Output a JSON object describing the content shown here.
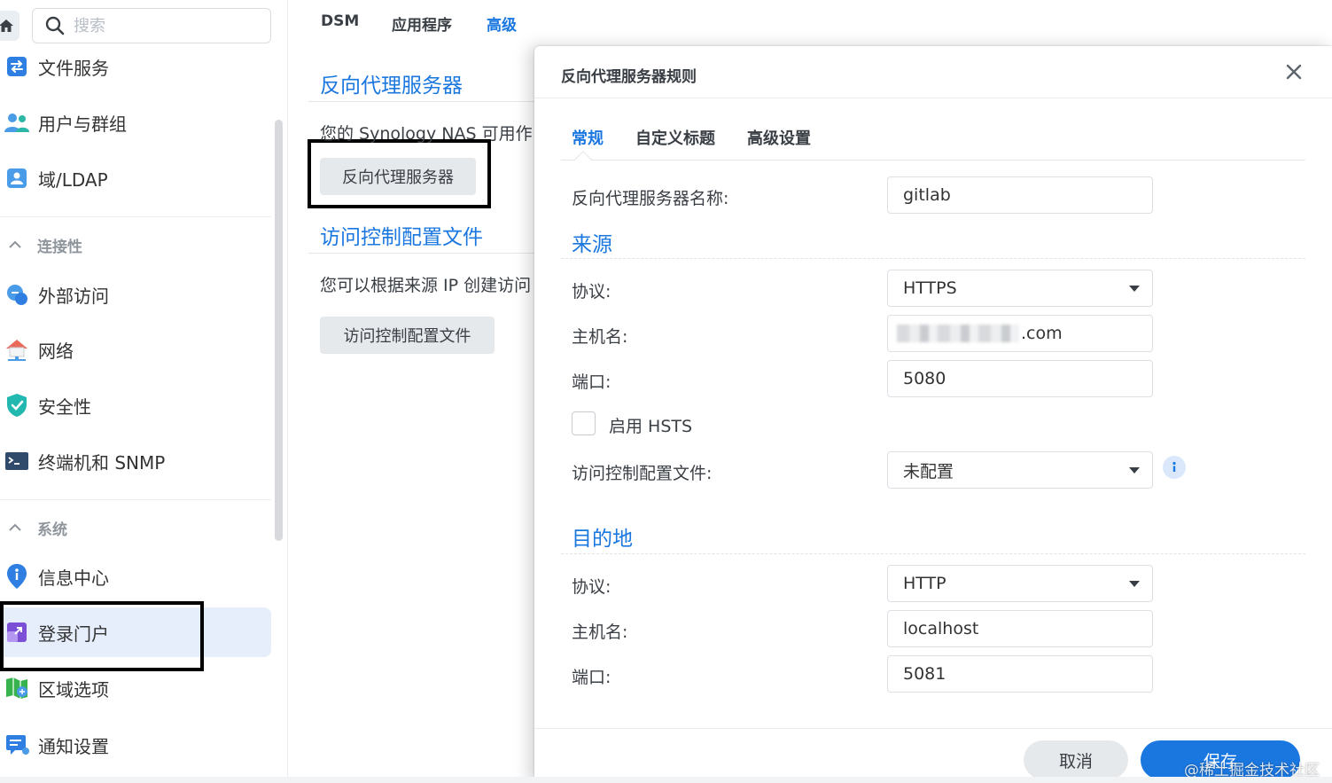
{
  "search": {
    "placeholder": "搜索"
  },
  "sidebar": {
    "items_top": [
      {
        "label": "文件服务",
        "icon": "file-services-icon"
      },
      {
        "label": "用户与群组",
        "icon": "user-group-icon"
      },
      {
        "label": "域/LDAP",
        "icon": "domain-ldap-icon"
      }
    ],
    "section_connectivity": "连接性",
    "items_connectivity": [
      {
        "label": "外部访问",
        "icon": "external-access-icon"
      },
      {
        "label": "网络",
        "icon": "network-icon"
      },
      {
        "label": "安全性",
        "icon": "security-icon"
      },
      {
        "label": "终端机和 SNMP",
        "icon": "terminal-icon"
      }
    ],
    "section_system": "系统",
    "items_system": [
      {
        "label": "信息中心",
        "icon": "info-center-icon"
      },
      {
        "label": "登录门户",
        "icon": "login-portal-icon",
        "selected": true
      },
      {
        "label": "区域选项",
        "icon": "regional-options-icon"
      },
      {
        "label": "通知设置",
        "icon": "notification-icon"
      }
    ]
  },
  "top_tabs": [
    {
      "label": "DSM",
      "active": false
    },
    {
      "label": "应用程序",
      "active": false
    },
    {
      "label": "高级",
      "active": true
    }
  ],
  "content": {
    "reverse_proxy_title": "反向代理服务器",
    "reverse_proxy_desc": "您的 Synology NAS 可用作",
    "reverse_proxy_button": "反向代理服务器",
    "access_control_title": "访问控制配置文件",
    "access_control_desc": "您可以根据来源 IP 创建访问",
    "access_control_button": "访问控制配置文件"
  },
  "dialog": {
    "title": "反向代理服务器规则",
    "tabs": [
      {
        "label": "常规",
        "active": true
      },
      {
        "label": "自定义标题",
        "active": false
      },
      {
        "label": "高级设置",
        "active": false
      }
    ],
    "name_label": "反向代理服务器名称:",
    "name_value": "gitlab",
    "source": {
      "title": "来源",
      "protocol_label": "协议:",
      "protocol_value": "HTTPS",
      "hostname_label": "主机名:",
      "hostname_suffix": ".com",
      "port_label": "端口:",
      "port_value": "5080",
      "hsts_label": "启用 HSTS",
      "hsts_checked": false,
      "acl_label": "访问控制配置文件:",
      "acl_value": "未配置"
    },
    "destination": {
      "title": "目的地",
      "protocol_label": "协议:",
      "protocol_value": "HTTP",
      "hostname_label": "主机名:",
      "hostname_value": "localhost",
      "port_label": "端口:",
      "port_value": "5081"
    },
    "cancel_label": "取消",
    "save_label": "保存"
  },
  "watermark": "@稀土掘金技术社区",
  "colors": {
    "accent": "#1a77e0",
    "selected_bg": "#e6eefc"
  }
}
